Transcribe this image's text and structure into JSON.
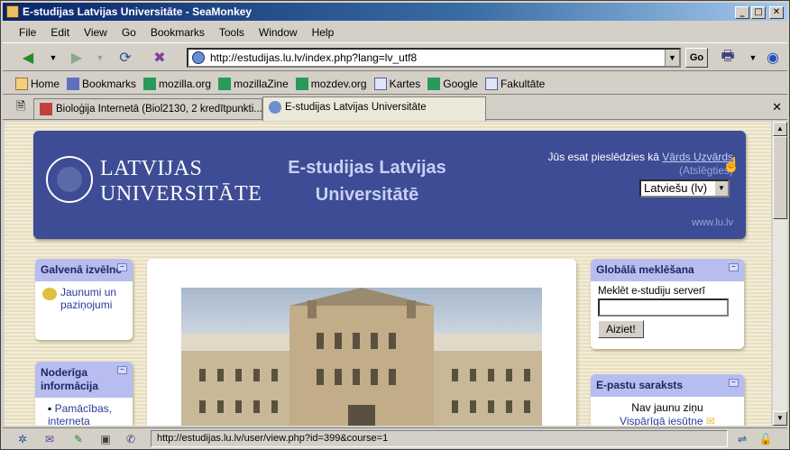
{
  "window": {
    "title": "E-studijas Latvijas Universitāte - SeaMonkey",
    "min": "_",
    "max": "□",
    "close": "✕"
  },
  "menu": [
    "File",
    "Edit",
    "View",
    "Go",
    "Bookmarks",
    "Tools",
    "Window",
    "Help"
  ],
  "nav": {
    "url": "http://estudijas.lu.lv/index.php?lang=lv_utf8",
    "go_label": "Go"
  },
  "bookmarks": [
    "Home",
    "Bookmarks",
    "mozilla.org",
    "mozillaZine",
    "mozdev.org",
    "Kartes",
    "Google",
    "Fakultāte"
  ],
  "tabs": [
    {
      "label": "Bioloģija Internetā (Biol2130, 2 kredītpunkti..."
    },
    {
      "label": "E-studijas Latvijas Universitāte"
    }
  ],
  "tab_close": "✕",
  "header": {
    "logo_line1": "LATVIJAS",
    "logo_line2": "UNIVERSITĀTE",
    "title": "E-studijas Latvijas Universitātē",
    "login_prefix": "Jūs esat pieslēdzies kā",
    "user_name": "Vārds Uzvārds",
    "logout": "(Atslēgties)",
    "language": "Latviešu (lv)",
    "site_link": "www.lu.lv"
  },
  "left_blocks": {
    "main_menu": {
      "title": "Galvenā izvēlne",
      "item": "Jaunumi un paziņojumi"
    },
    "useful": {
      "title": "Noderīga informācija",
      "item": "Pamācības, interneta"
    }
  },
  "right_blocks": {
    "search": {
      "title": "Globālā meklēšana",
      "label": "Meklēt e-studiju serverī",
      "button": "Aiziet!"
    },
    "mail": {
      "title": "E-pastu saraksts",
      "line1": "Nav jaunu ziņu",
      "line2": "Vispārīgā iesūtne"
    }
  },
  "status": {
    "text": "http://estudijas.lu.lv/user/view.php?id=399&course=1"
  },
  "colors": {
    "header_bg": "#3d4c94",
    "block_head": "#b8bdf0",
    "title_bar": "#0a246a"
  }
}
